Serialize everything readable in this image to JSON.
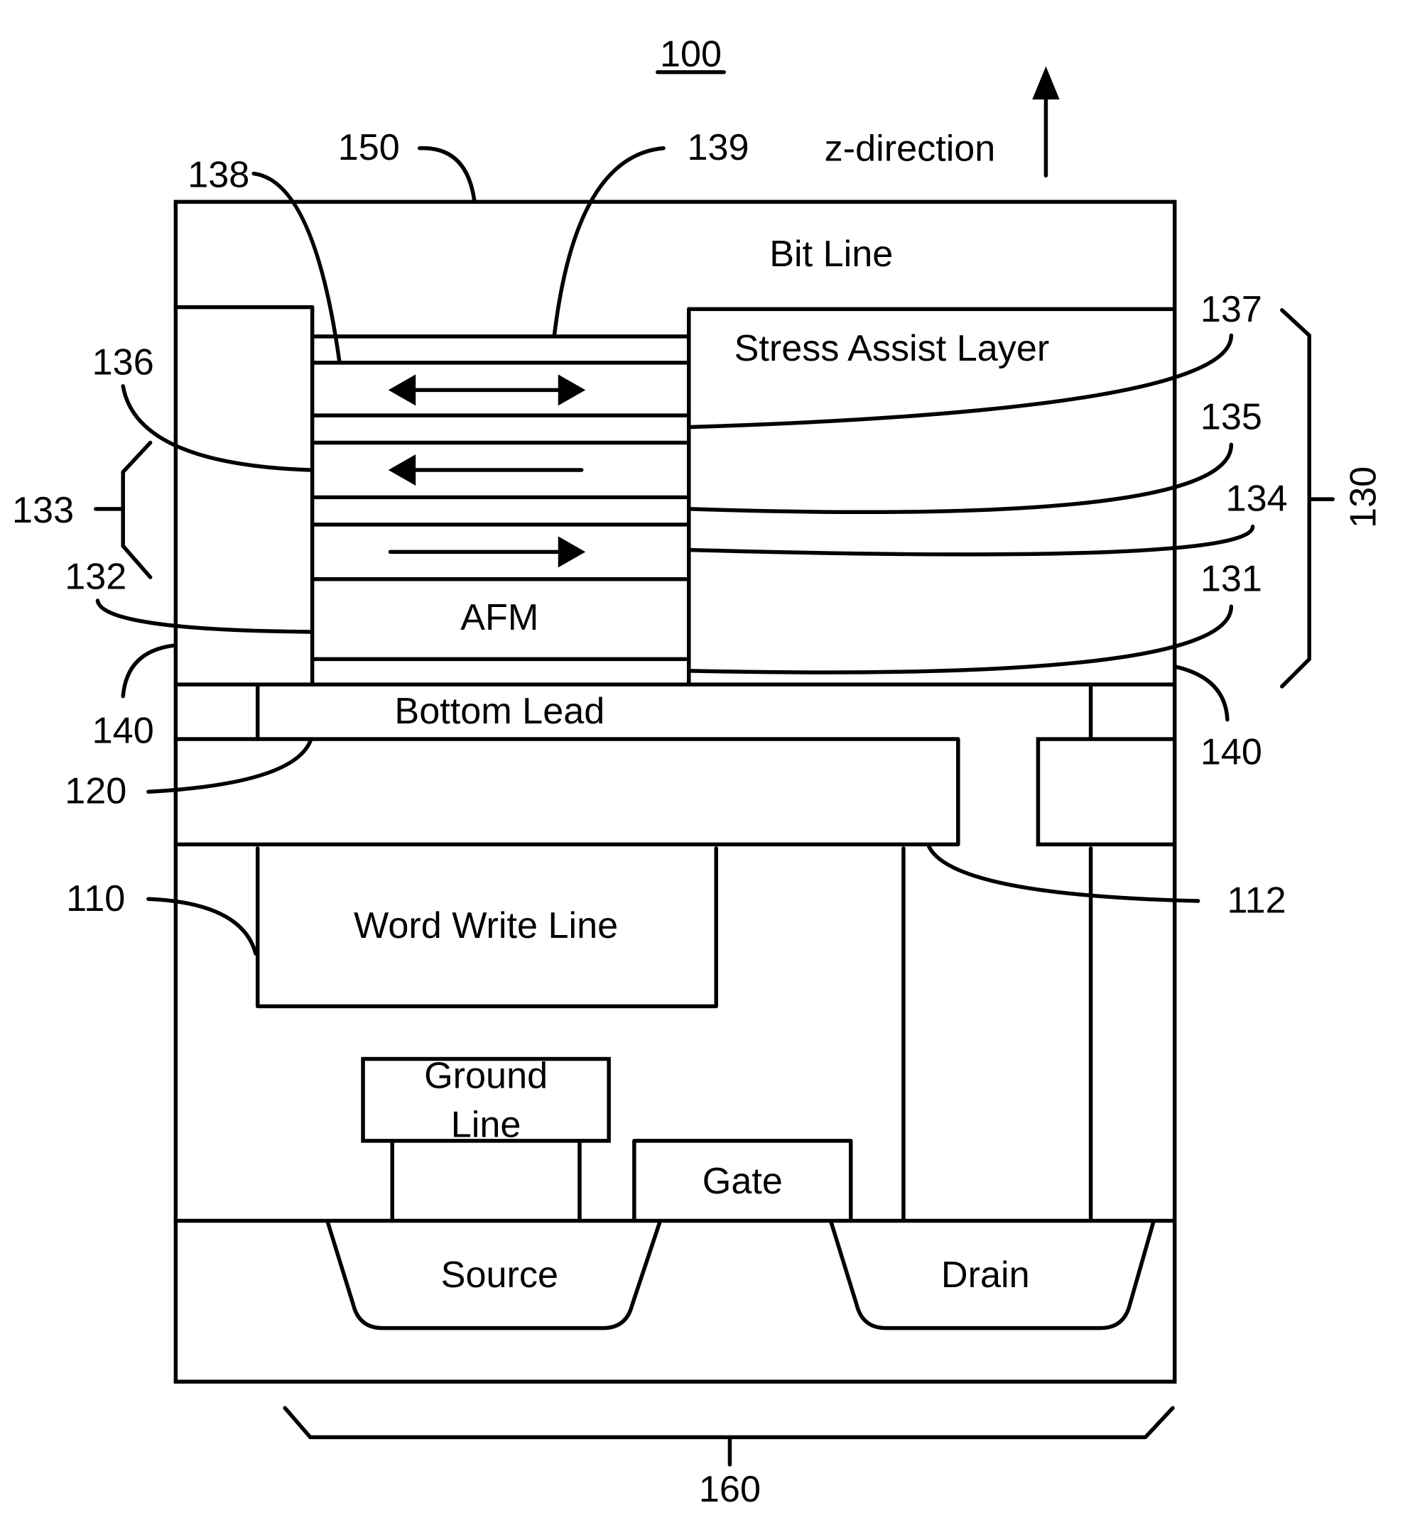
{
  "figure": {
    "ref_number": "100",
    "direction_label": "z-direction",
    "layers": {
      "bit_line": "Bit Line",
      "stress_assist_layer": "Stress Assist Layer",
      "afm": "AFM",
      "bottom_lead": "Bottom Lead",
      "word_write_line": "Word Write Line",
      "ground_line_1": "Ground",
      "ground_line_2": "Line",
      "gate": "Gate",
      "source": "Source",
      "drain": "Drain"
    },
    "refs": {
      "r150": "150",
      "r138": "138",
      "r139": "139",
      "r137": "137",
      "r136": "136",
      "r135": "135",
      "r134": "134",
      "r133": "133",
      "r132": "132",
      "r131": "131",
      "r130": "130",
      "r140_left": "140",
      "r140_right": "140",
      "r120": "120",
      "r112": "112",
      "r110": "110",
      "r160": "160"
    },
    "magnetization": {
      "free_layer": "bidirectional",
      "reference_layer": "left",
      "pinned_layer": "right"
    }
  }
}
